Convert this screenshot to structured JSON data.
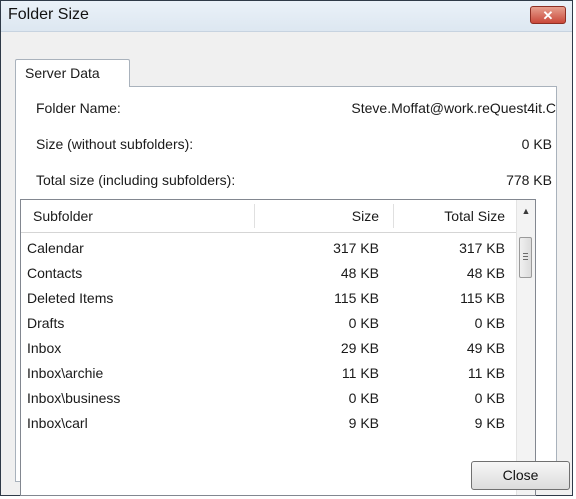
{
  "window": {
    "title": "Folder Size"
  },
  "tabs": [
    {
      "label": "Server Data"
    }
  ],
  "info": {
    "folder_name_label": "Folder Name:",
    "folder_name_value": "Steve.Moffat@work.reQuest4it.C",
    "size_label": "Size (without subfolders):",
    "size_value": "0 KB",
    "total_label": "Total size (including subfolders):",
    "total_value": "778 KB"
  },
  "table": {
    "columns": [
      "Subfolder",
      "Size",
      "Total Size"
    ],
    "rows": [
      {
        "name": "Calendar",
        "size": "317 KB",
        "total": "317 KB"
      },
      {
        "name": "Contacts",
        "size": "48 KB",
        "total": "48 KB"
      },
      {
        "name": "Deleted Items",
        "size": "115 KB",
        "total": "115 KB"
      },
      {
        "name": "Drafts",
        "size": "0 KB",
        "total": "0 KB"
      },
      {
        "name": "Inbox",
        "size": "29 KB",
        "total": "49 KB"
      },
      {
        "name": "Inbox\\archie",
        "size": "11 KB",
        "total": "11 KB"
      },
      {
        "name": "Inbox\\business",
        "size": "0 KB",
        "total": "0 KB"
      },
      {
        "name": "Inbox\\carl",
        "size": "9 KB",
        "total": "9 KB"
      }
    ]
  },
  "buttons": {
    "close_label": "Close",
    "title_close_glyph": "✕"
  },
  "icons": {
    "scroll_up": "▲",
    "scroll_down": "▼"
  }
}
